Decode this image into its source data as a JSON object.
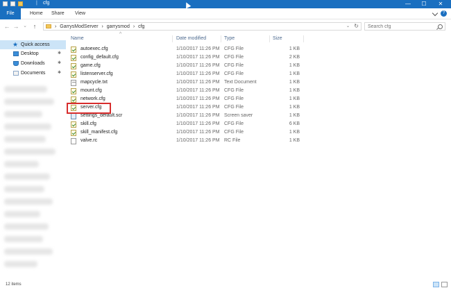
{
  "window": {
    "title": "cfg",
    "minimize": "—",
    "maximize": "☐",
    "close": "✕"
  },
  "ribbon": {
    "tabs": [
      "File",
      "Home",
      "Share",
      "View"
    ],
    "help": "?"
  },
  "nav": {
    "back": "←",
    "forward": "→",
    "recent": "⌄",
    "up": "↑"
  },
  "address": {
    "crumbs": [
      "GarrysModServer",
      "garrysmod",
      "cfg"
    ],
    "separator": "›",
    "dropdown": "⌄",
    "refresh": "↻"
  },
  "search": {
    "placeholder": "Search cfg"
  },
  "sidebar": {
    "quick_access": "Quick access",
    "items": [
      {
        "label": "Desktop",
        "icon": "desktop-icon",
        "pin": "✱"
      },
      {
        "label": "Downloads",
        "icon": "downloads-icon",
        "pin": "✱"
      },
      {
        "label": "Documents",
        "icon": "documents-icon",
        "pin": "✱"
      }
    ]
  },
  "columns": {
    "name": "Name",
    "date": "Date modified",
    "type": "Type",
    "size": "Size",
    "sort_caret": "^"
  },
  "files": [
    {
      "name": "autoexec.cfg",
      "date": "1/10/2017 11:26 PM",
      "type": "CFG File",
      "size": "1 KB",
      "icon": "cfg"
    },
    {
      "name": "config_default.cfg",
      "date": "1/10/2017 11:26 PM",
      "type": "CFG File",
      "size": "2 KB",
      "icon": "cfg"
    },
    {
      "name": "game.cfg",
      "date": "1/10/2017 11:26 PM",
      "type": "CFG File",
      "size": "1 KB",
      "icon": "cfg"
    },
    {
      "name": "listenserver.cfg",
      "date": "1/10/2017 11:26 PM",
      "type": "CFG File",
      "size": "1 KB",
      "icon": "cfg"
    },
    {
      "name": "mapcycle.txt",
      "date": "1/10/2017 11:26 PM",
      "type": "Text Document",
      "size": "1 KB",
      "icon": "txt"
    },
    {
      "name": "mount.cfg",
      "date": "1/10/2017 11:26 PM",
      "type": "CFG File",
      "size": "1 KB",
      "icon": "cfg"
    },
    {
      "name": "network.cfg",
      "date": "1/10/2017 11:26 PM",
      "type": "CFG File",
      "size": "1 KB",
      "icon": "cfg"
    },
    {
      "name": "server.cfg",
      "date": "1/10/2017 11:26 PM",
      "type": "CFG File",
      "size": "1 KB",
      "icon": "cfg"
    },
    {
      "name": "settings_default.scr",
      "date": "1/10/2017 11:26 PM",
      "type": "Screen saver",
      "size": "1 KB",
      "icon": "scr"
    },
    {
      "name": "skill.cfg",
      "date": "1/10/2017 11:26 PM",
      "type": "CFG File",
      "size": "6 KB",
      "icon": "cfg"
    },
    {
      "name": "skill_manifest.cfg",
      "date": "1/10/2017 11:26 PM",
      "type": "CFG File",
      "size": "1 KB",
      "icon": "cfg"
    },
    {
      "name": "valve.rc",
      "date": "1/10/2017 11:26 PM",
      "type": "RC File",
      "size": "1 KB",
      "icon": "rc"
    }
  ],
  "status": {
    "items": "12 items"
  },
  "colors": {
    "accent": "#1a6fc0",
    "highlight_box": "#d72c2c",
    "selected": "#cce4f7"
  }
}
